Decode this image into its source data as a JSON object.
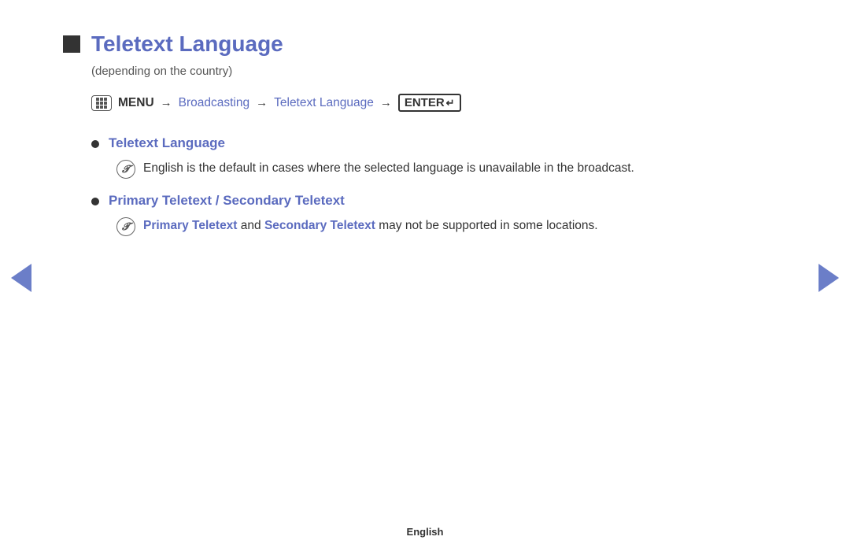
{
  "page": {
    "title": "Teletext Language",
    "subtitle": "(depending on the country)",
    "menu_path": {
      "menu_label": "MENU",
      "arrow1": "→",
      "broadcasting": "Broadcasting",
      "arrow2": "→",
      "teletext_language": "Teletext Language",
      "arrow3": "→",
      "enter_label": "ENTER"
    },
    "bullet_items": [
      {
        "label": "Teletext Language",
        "note": "English is the default in cases where the selected language is unavailable in the broadcast."
      },
      {
        "label": "Primary Teletext / Secondary Teletext",
        "note_prefix_1": "Primary Teletext",
        "note_middle": " and ",
        "note_prefix_2": "Secondary Teletext",
        "note_suffix": " may not be supported in some locations."
      }
    ],
    "footer": "English"
  },
  "colors": {
    "blue": "#5b6bbf",
    "dark": "#333333",
    "gray": "#555555"
  }
}
